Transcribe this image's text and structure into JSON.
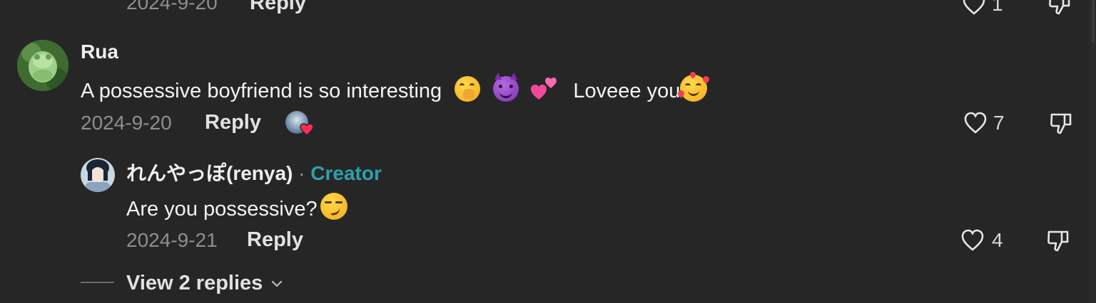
{
  "top_partial": {
    "date": "2024-9-20",
    "reply_label": "Reply",
    "like_count": "1"
  },
  "comment": {
    "username": "Rua",
    "text_before": "A possessive boyfriend is so interesting",
    "text_after": "Loveee you",
    "emojis": [
      "hand-over-mouth-emoji",
      "smiling-devil-emoji",
      "two-hearts-emoji",
      "smiling-face-with-hearts-emoji"
    ],
    "date": "2024-9-20",
    "reply_label": "Reply",
    "like_count": "7"
  },
  "reply": {
    "username": "れんやっぽ(renya)",
    "separator": "·",
    "badge": "Creator",
    "text": "Are you possessive?",
    "emoji": "smirking-face-emoji",
    "date": "2024-9-21",
    "reply_label": "Reply",
    "like_count": "4"
  },
  "view_replies": {
    "label": "View 2 replies"
  },
  "colors": {
    "background": "#262626",
    "creator_badge": "#2ea0ad",
    "liked_heart": "#fe2c55"
  }
}
